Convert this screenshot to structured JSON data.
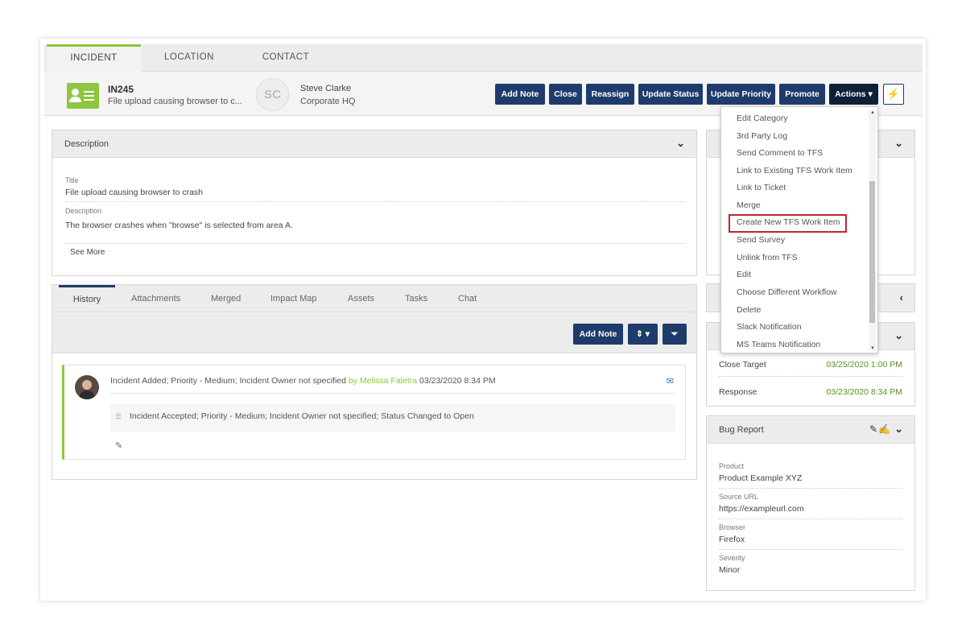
{
  "tabs": [
    "INCIDENT",
    "LOCATION",
    "CONTACT"
  ],
  "incident": {
    "id": "IN245",
    "title": "File upload causing browser to c...",
    "icon": "contact-card-icon"
  },
  "contact": {
    "initials": "SC",
    "name": "Steve Clarke",
    "location": "Corporate HQ"
  },
  "buttons": {
    "add_note": "Add Note",
    "close": "Close",
    "reassign": "Reassign",
    "update_status": "Update Status",
    "update_priority": "Update Priority",
    "promote": "Promote",
    "actions": "Actions ▾",
    "bolt": "⚡"
  },
  "actions_menu": [
    "Edit Category",
    "3rd Party Log",
    "Send Comment to TFS",
    "Link to Existing TFS Work Item",
    "Link to Ticket",
    "Merge",
    "Create New TFS Work Item",
    "Send Survey",
    "Unlink from TFS",
    "Edit",
    "Choose Different Workflow",
    "Delete",
    "Slack Notification",
    "MS Teams Notification"
  ],
  "description": {
    "header": "Description",
    "title_label": "Title",
    "title_value": "File upload causing browser to crash",
    "desc_label": "Description",
    "desc_value": "The browser crashes when \"browse\" is selected from area A.",
    "see_more": "See More"
  },
  "subtabs": [
    "History",
    "Attachments",
    "Merged",
    "Impact Map",
    "Assets",
    "Tasks",
    "Chat"
  ],
  "history_toolbar": {
    "add_note": "Add Note",
    "sort": "⇕ ▾",
    "filter": "⏷"
  },
  "history": {
    "entry_text": "Incident Added; Priority - Medium; Incident Owner not specified",
    "by_label": "by Melissa Faletra",
    "timestamp": "03/23/2020 8:34 PM",
    "sub_entry": "Incident Accepted; Priority - Medium; Incident Owner not specified; Status Changed to Open"
  },
  "sla": {
    "close_target_label": "Close Target",
    "close_target_value": "03/25/2020 1:00 PM",
    "response_label": "Response",
    "response_value": "03/23/2020 8:34 PM"
  },
  "bug_report": {
    "header": "Bug Report",
    "product_label": "Product",
    "product_value": "Product Example XYZ",
    "source_label": "Source URL",
    "source_value": "https://exampleurl.com",
    "browser_label": "Browser",
    "browser_value": "Firefox",
    "severity_label": "Severity",
    "severity_value": "Minor"
  },
  "colors": {
    "accent_green": "#8dc63f",
    "button_navy": "#1d3c6b",
    "highlight_red": "#c0272d"
  }
}
